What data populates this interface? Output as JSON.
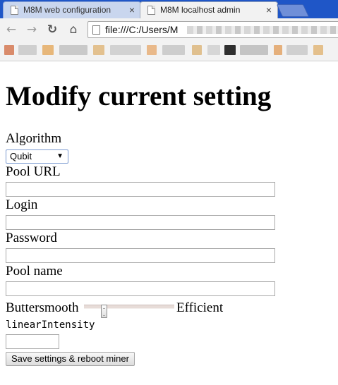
{
  "browser": {
    "tabs": [
      {
        "title": "M8M web configuration",
        "active": false
      },
      {
        "title": "M8M localhost admin",
        "active": true
      }
    ],
    "tab_close_glyph": "×",
    "address": "file:///C:/Users/M",
    "icons": {
      "back": "back-arrow-icon",
      "forward": "forward-arrow-icon",
      "reload": "reload-icon",
      "home": "home-icon",
      "page": "page-icon"
    },
    "glyphs": {
      "back": "←",
      "forward": "→",
      "reload": "↻",
      "home": "⌂"
    }
  },
  "page": {
    "title": "Modify current setting",
    "algorithm": {
      "label": "Algorithm",
      "selected": "Qubit"
    },
    "pool_url": {
      "label": "Pool URL",
      "value": ""
    },
    "login": {
      "label": "Login",
      "value": ""
    },
    "password": {
      "label": "Password",
      "value": ""
    },
    "pool_name": {
      "label": "Pool name",
      "value": ""
    },
    "intensity": {
      "left_label": "Buttersmooth",
      "right_label": "Efficient",
      "position_fraction": 0.2,
      "name_label": "linearIntensity",
      "value": ""
    },
    "save_button_label": "Save settings & reboot miner"
  },
  "colors": {
    "tabstrip": "#1f56c7",
    "toolbar": "#f2f2f2",
    "select_border": "#7b9ad0",
    "slider_track": "#e7dcd8"
  }
}
